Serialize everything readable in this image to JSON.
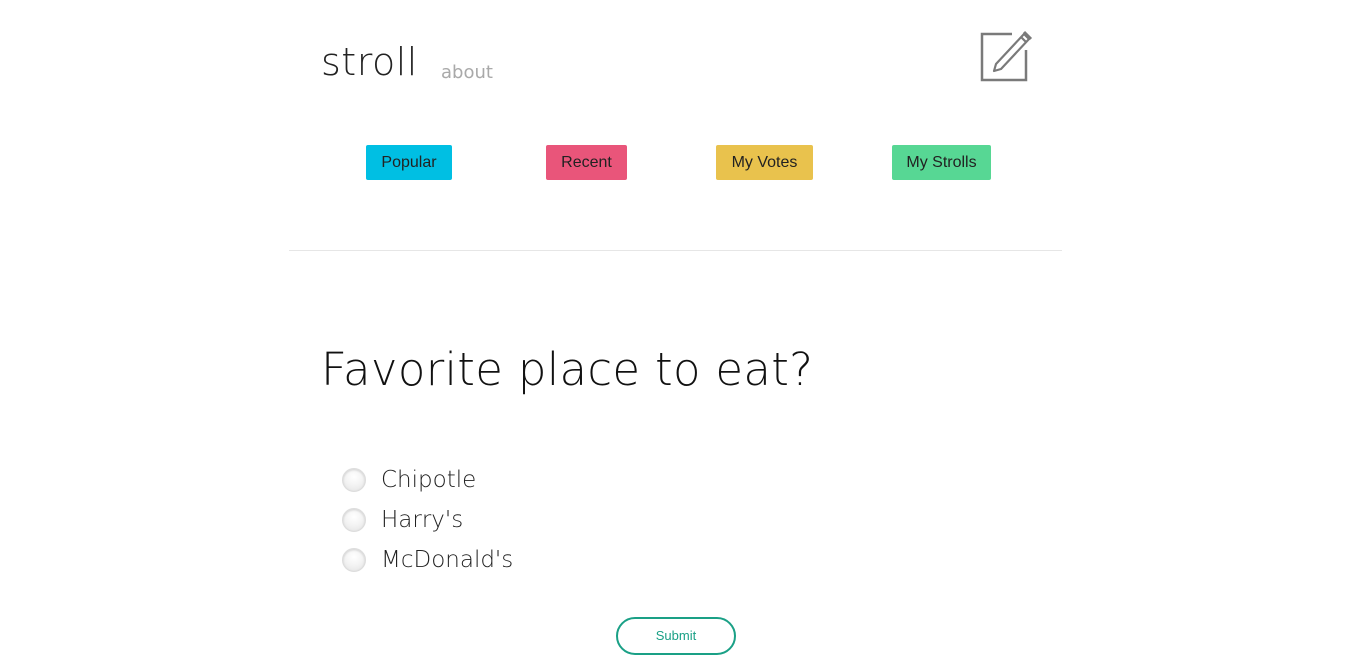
{
  "header": {
    "logo_text": "stroll",
    "about_label": "about",
    "compose_icon": "edit-square-pencil-icon"
  },
  "nav": {
    "items": [
      {
        "label": "Popular",
        "color": "#00bfe3"
      },
      {
        "label": "Recent",
        "color": "#e9557a"
      },
      {
        "label": "My Votes",
        "color": "#e9c24d"
      },
      {
        "label": "My Strolls",
        "color": "#57d794"
      }
    ]
  },
  "poll": {
    "question": "Favorite place to eat?",
    "options": [
      {
        "label": "Chipotle",
        "selected": false
      },
      {
        "label": "Harry's",
        "selected": false
      },
      {
        "label": "McDonald's",
        "selected": false
      }
    ],
    "submit_label": "Submit",
    "submit_color": "#1aa086"
  }
}
